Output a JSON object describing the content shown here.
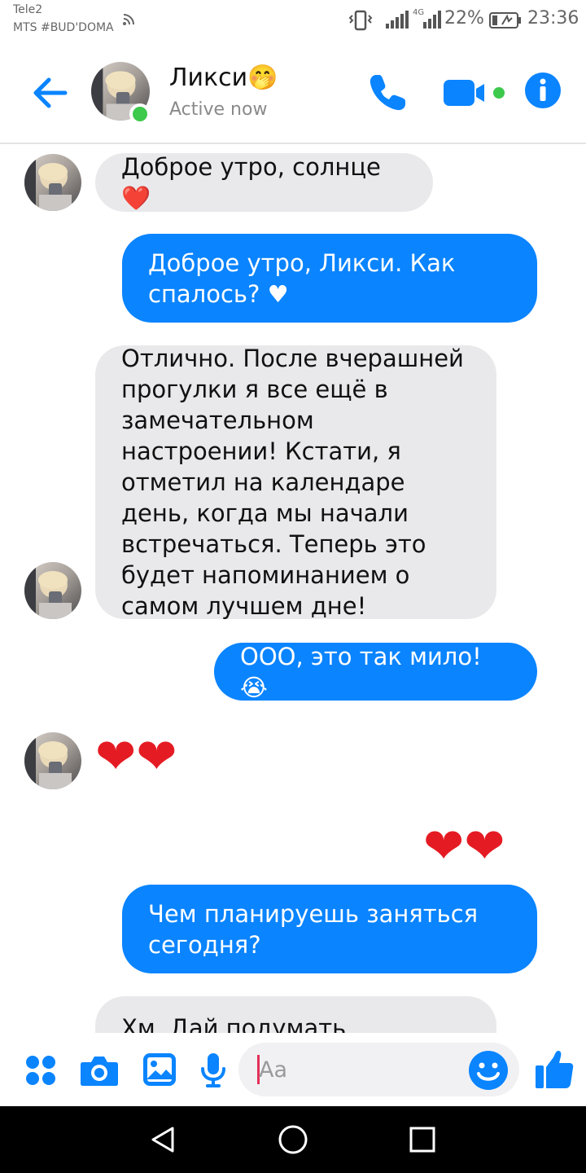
{
  "status_bar": {
    "carrier_1": "Tele2",
    "carrier_2": "MTS #BUD'DOMA",
    "network_type": "4G",
    "battery_percent": "22%",
    "battery_level": 0.22,
    "time": "23:36"
  },
  "header": {
    "contact_name": "Ликси🤭",
    "contact_status": "Active now"
  },
  "messages": [
    {
      "from": "contact",
      "text": "Доброе утро, солнце ❤️"
    },
    {
      "from": "me",
      "text": "Доброе утро, Ликси. Как спалось? ♥"
    },
    {
      "from": "contact",
      "text": "Отлично. После вчерашней прогулки я все ещё в замечательном настроении! Кстати, я отметил на календаре день, когда мы начали встречаться. Теперь это будет напоминанием о самом лучшем дне!"
    },
    {
      "from": "me",
      "text": "ООО, это так мило! 😭"
    },
    {
      "from": "contact",
      "text": "❤❤"
    },
    {
      "from": "me",
      "text": "❤❤"
    },
    {
      "from": "me",
      "text": "Чем планируешь заняться сегодня?"
    },
    {
      "from": "contact",
      "text": "Хм. Дай подумать"
    }
  ],
  "composer": {
    "placeholder": "Aa"
  },
  "icons": {
    "back": "arrow-left-icon",
    "call": "phone-icon",
    "video": "video-camera-icon",
    "info": "info-icon",
    "apps": "grid-dots-icon",
    "camera": "camera-icon",
    "gallery": "image-icon",
    "mic": "microphone-icon",
    "emoji": "smiley-icon",
    "like": "thumbs-up-icon"
  },
  "colors": {
    "accent": "#0a84ff",
    "incoming_bubble": "#e9e9eb",
    "online": "#3dc94c",
    "heart": "#e51b23"
  }
}
